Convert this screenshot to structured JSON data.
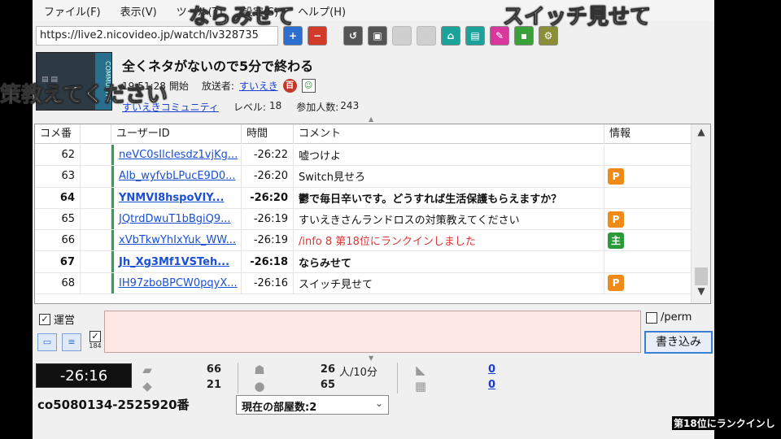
{
  "menu": {
    "file": "ファイル(F)",
    "view": "表示(V)",
    "tools": "ツール(T)",
    "settings": "設定(S)",
    "help": "ヘルプ(H)"
  },
  "address": {
    "url": "https://live2.nicovideo.jp/watch/lv328735"
  },
  "program": {
    "title": "全くネタがないので5分で終わる",
    "start_time": "19:51:28",
    "start_label": "開始",
    "broadcaster_label": "放送者:",
    "broadcaster": "すいえき",
    "community": "すいえきコミュニティ",
    "level_label": "レベル:",
    "level": "18",
    "participants_label": "参加人数:",
    "participants": "243",
    "thumbnail_text": "COMMUNITY"
  },
  "table": {
    "headers": [
      "コメ番",
      "",
      "ユーザーID",
      "時間",
      "コメント",
      "情報"
    ],
    "rows": [
      {
        "no": "62",
        "uid": "neVC0sIlcIesdz1vjKg...",
        "time": "-26:22",
        "comment": "嘘つけよ",
        "info": ""
      },
      {
        "no": "63",
        "uid": "Alb_wyfvbLPucE9D0...",
        "time": "-26:20",
        "comment": "Switch見せろ",
        "info": "P"
      },
      {
        "no": "64",
        "uid": "YNMVI8hspoVIY...",
        "time": "-26:20",
        "comment": "鬱で毎日辛いです。どうすれば生活保護もらえますか？",
        "info": ""
      },
      {
        "no": "65",
        "uid": "JQtrdDwuT1bBgiQ9...",
        "time": "-26:19",
        "comment": "すいえきさんランドロスの対策教えてください",
        "info": "P"
      },
      {
        "no": "66",
        "uid": "xVbTkwYhIxYuk_WW...",
        "time": "-26:19",
        "comment": "/info 8 第18位にランクインしました",
        "info": "主"
      },
      {
        "no": "67",
        "uid": "Jh_Xg3Mf1VSTeh...",
        "time": "-26:18",
        "comment": "ならみせて",
        "info": ""
      },
      {
        "no": "68",
        "uid": "IH97zboBPCW0pqyX...",
        "time": "-26:16",
        "comment": "スイッチ見せて",
        "info": "P"
      }
    ]
  },
  "input": {
    "operator_label": "運営",
    "perm_label": "/perm",
    "write_button": "書き込み",
    "count": "184"
  },
  "stats": {
    "elapsed": "-26:16",
    "comments_total": "66",
    "comments_recent": "21",
    "viewers_rate": "26",
    "viewers_rate_unit": "人/10分",
    "viewers_recent": "65",
    "ad_points": "0",
    "gift_points": "0"
  },
  "footer": {
    "live_id": "co5080134-2525920番",
    "room_count": "現在の部屋数:2"
  },
  "overlays": {
    "top_center": "ならみせて",
    "top_right": "スイッチ見せて",
    "left": "策教えてください",
    "ranking": "第18位にランクインし"
  }
}
